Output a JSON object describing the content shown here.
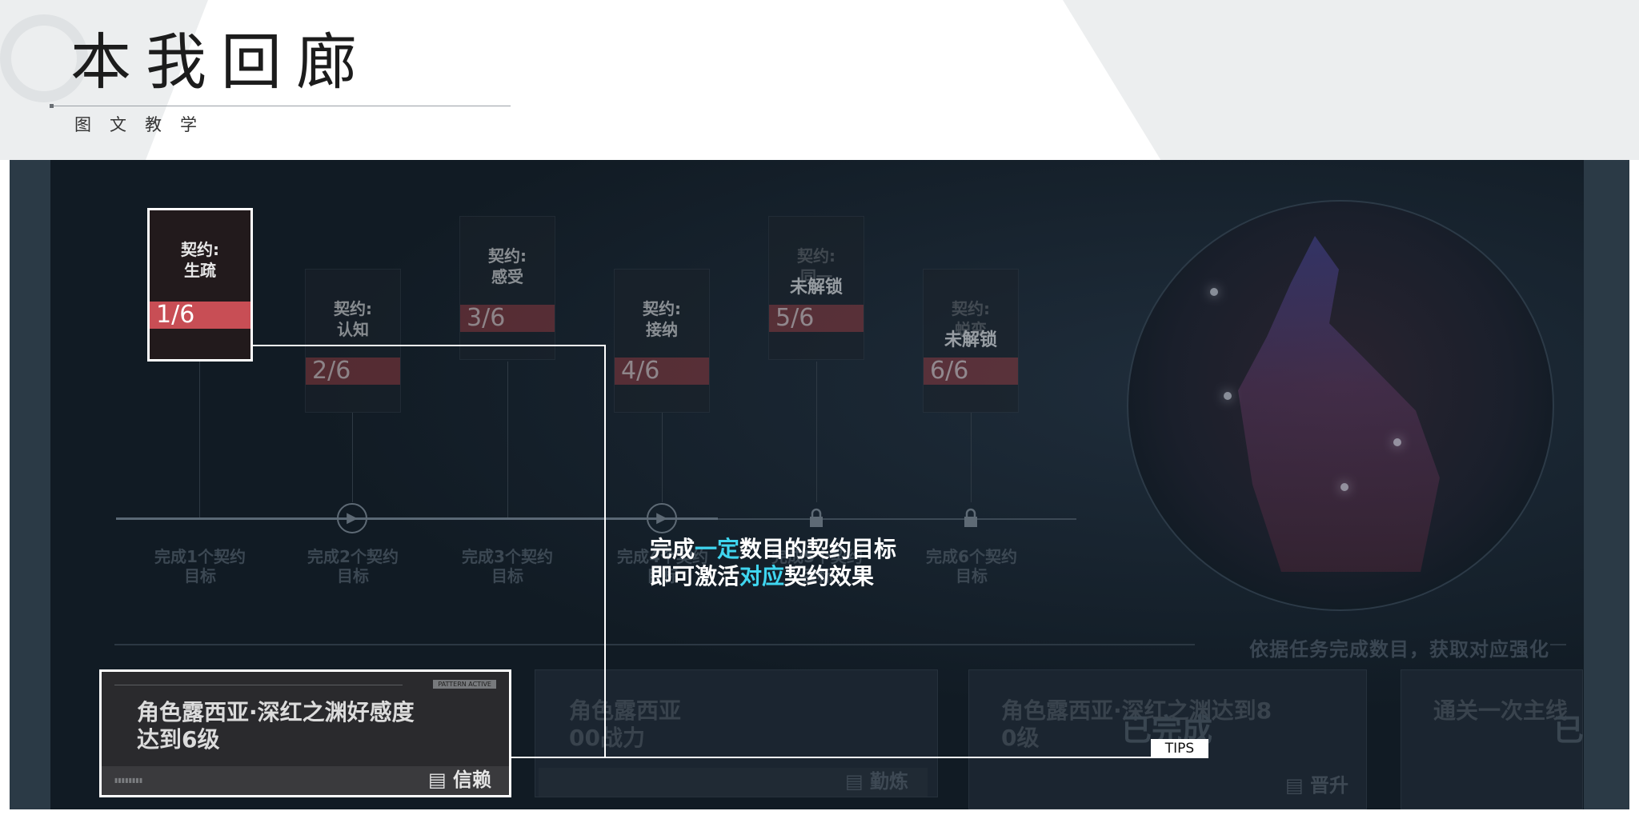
{
  "header": {
    "title": "本我回廊",
    "subtitle": "图文教学"
  },
  "contracts": [
    {
      "label": "契约:\n生疏",
      "progress": "1/6",
      "state": "active"
    },
    {
      "label": "契约:\n认知",
      "progress": "2/6",
      "state": "dim"
    },
    {
      "label": "契约:\n感受",
      "progress": "3/6",
      "state": "dim"
    },
    {
      "label": "契约:\n接纳",
      "progress": "4/6",
      "state": "dim"
    },
    {
      "label": "契约:\n同一",
      "progress": "5/6",
      "state": "locked",
      "lock_label": "未解锁"
    },
    {
      "label": "契约:\n蜕变",
      "progress": "6/6",
      "state": "locked",
      "lock_label": "未解锁"
    }
  ],
  "timeline": [
    {
      "label": "完成1个契约\n目标",
      "icon": "none"
    },
    {
      "label": "完成2个契约\n目标",
      "icon": "play-icon"
    },
    {
      "label": "完成3个契约\n目标",
      "icon": "none"
    },
    {
      "label": "完成4个契约\n目标",
      "icon": "play-icon"
    },
    {
      "label": "完成5个契约\n目标",
      "icon": "lock-icon"
    },
    {
      "label": "完成6个契约\n目标",
      "icon": "lock-icon"
    }
  ],
  "hint": "依据任务完成数目，获取对应强化",
  "tasks": [
    {
      "text": "角色露西亚·深红之渊好感度\n达到6级",
      "button": "信赖",
      "tag": "PATTERN ACTIVE"
    },
    {
      "text": "角色露西亚\n00战力",
      "button": "勤炼"
    },
    {
      "text": "角色露西亚·深红之渊达到8\n0级",
      "button": "晋升",
      "done": "已完成"
    },
    {
      "text": "通关一次主线",
      "done": "已"
    }
  ],
  "callout": {
    "line1_a": "完成",
    "line1_hl": "一定",
    "line1_b": "数目的契约目标",
    "line2_a": "即可激活",
    "line2_hl": "对应",
    "line2_b": "契约效果",
    "tips": "TIPS"
  },
  "colors": {
    "highlight": "#3fd6f0",
    "progress_red": "#c84e55",
    "panel_bg": "#111b24"
  }
}
